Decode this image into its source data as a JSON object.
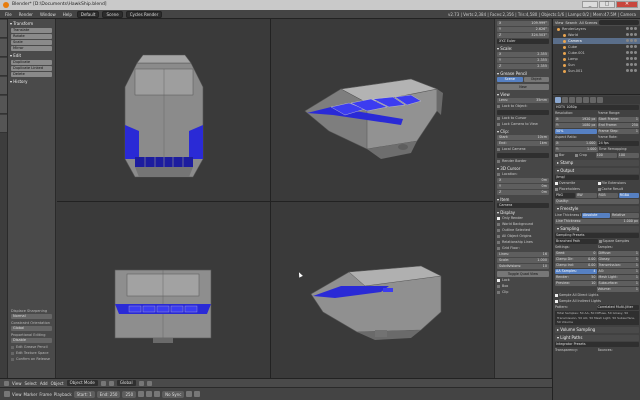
{
  "window": {
    "title": "Blender* [D:\\Documents\\HawkShip.blend]",
    "buttons": [
      "_",
      "□",
      "✕"
    ]
  },
  "infobar": {
    "menus": [
      "File",
      "Render",
      "Window",
      "Help"
    ],
    "layout": "Default",
    "scene": "Scene",
    "engine": "Cycles Render",
    "stats": "v2.73 | Verts:2,384 | Faces:2,356 | Tris:4,580 | Objects:1/6 | Lamps:0/2 | Mem:47.5M | Camera"
  },
  "toolshelf": {
    "transform_header": "Transform",
    "transform_buttons": [
      "Translate",
      "Rotate",
      "Scale",
      "Mirror"
    ],
    "edit_header": "Edit",
    "edit_buttons": [
      "Duplicate",
      "Duplicate Linked",
      "Delete"
    ],
    "history_header": "History",
    "operator": {
      "label1": "Displace Sharpening",
      "field1": "Normal",
      "label2": "Constraint Orientation",
      "field2": "Global",
      "label3": "Proportional Editing",
      "field3": "Disable",
      "checks": [
        "Edit Grease Pencil",
        "Edit Texture Space",
        "Confirm on Release"
      ]
    }
  },
  "npanel": {
    "rotation": [
      {
        "axis": "X",
        "value": "109.999°"
      },
      {
        "axis": "Y",
        "value": "2.626°"
      },
      {
        "axis": "Z",
        "value": "324.503°"
      }
    ],
    "rot_mode": "XYZ Euler",
    "scale_header": "Scale:",
    "scale": [
      {
        "axis": "X",
        "value": "2.355"
      },
      {
        "axis": "Y",
        "value": "2.355"
      },
      {
        "axis": "Z",
        "value": "2.355"
      }
    ],
    "grease_header": "Grease Pencil",
    "grease_buttons": [
      "Scene",
      "Object"
    ],
    "grease_new": "New",
    "view_header": "View",
    "lens": {
      "label": "Lens:",
      "value": "35mm"
    },
    "lock_object": "Lock to Object:",
    "lock_cursor": "Lock to Cursor",
    "lock_camera": "Lock Camera to View",
    "clip_header": "Clip:",
    "clip_start": {
      "label": "Start:",
      "value": "10cm"
    },
    "clip_end": {
      "label": "End:",
      "value": "1km"
    },
    "local_camera": "Local Camera:",
    "render_border": "Render Border",
    "cursor_header": "3D Cursor",
    "location_label": "Location:",
    "cursor": [
      {
        "axis": "X",
        "value": "0m"
      },
      {
        "axis": "Y",
        "value": "0m"
      },
      {
        "axis": "Z",
        "value": "0m"
      }
    ],
    "item_header": "Item",
    "item_name": "Camera",
    "display_header": "Display",
    "display_checks": [
      "Only Render",
      "World Background",
      "Outline Selected",
      "All Object Origins",
      "Relationship Lines"
    ],
    "grid_floor": "Grid Floor:",
    "lines": {
      "label": "Lines:",
      "value": "16"
    },
    "grid_scale": {
      "label": "Scale:",
      "value": "1.000"
    },
    "subdivisions": {
      "label": "Subdivisions:",
      "value": "10"
    },
    "toggle_quad": "Toggle Quad View",
    "quad_checks": [
      "Lock",
      "Box",
      "Clip"
    ]
  },
  "outliner": {
    "view_menu": "View",
    "search_menu": "Search",
    "scenes": "All Scenes",
    "items": [
      {
        "name": "RenderLayers",
        "sel": false
      },
      {
        "name": "World",
        "sel": false
      },
      {
        "name": "Camera",
        "sel": true
      },
      {
        "name": "Cube",
        "sel": false
      },
      {
        "name": "Cube.001",
        "sel": false
      },
      {
        "name": "Lamp",
        "sel": false
      },
      {
        "name": "Sun",
        "sel": false
      },
      {
        "name": "Sun.001",
        "sel": false
      }
    ]
  },
  "properties": {
    "preset": "HDTV 1080p",
    "resolution_label": "Resolution:",
    "frame_range_label": "Frame Range:",
    "res_x": {
      "label": "X:",
      "value": "1920 px"
    },
    "res_y": {
      "label": "Y:",
      "value": "1080 px"
    },
    "res_pct": "50%",
    "start_frame": {
      "label": "Start Frame:",
      "value": "1"
    },
    "end_frame": {
      "label": "End Frame:",
      "value": "250"
    },
    "frame_step": {
      "label": "Frame Step:",
      "value": "1"
    },
    "aspect_label": "Aspect Ratio:",
    "frame_rate_label": "Frame Rate:",
    "aspect_x": {
      "label": "X:",
      "value": "1.000"
    },
    "aspect_y": {
      "label": "Y:",
      "value": "1.000"
    },
    "fps": "24 fps",
    "time_remap": "Time Remapping:",
    "border": "Bor",
    "crop": "Crop",
    "remap_old": "100",
    "remap_new": "100",
    "stamp_header": "Stamp",
    "output_header": "Output",
    "output_path": "/tmp/",
    "overwrite": "Overwrite",
    "file_ext": "File Extensions",
    "placeholders": "Placeholders",
    "cache_result": "Cache Result",
    "format": "PNG",
    "bw": "BW",
    "rgb": "RGB",
    "rgba": "RGBA",
    "quality": "Quality:",
    "freestyle_header": "Freestyle",
    "line_thickness": "Line Thickness Mode:",
    "absolute": "Absolute",
    "relative": "Relative",
    "line_thick_value": "Line Thickness:",
    "line_thick_num": "1.000 px",
    "sampling_header": "Sampling",
    "sampling_presets": "Sampling Presets",
    "branched_path": "Branched Path",
    "square_samples": "Square Samples",
    "settings_label": "Settings:",
    "samples_label": "Samples:",
    "seed": {
      "label": "Seed:",
      "value": "0"
    },
    "clamp_dir": {
      "label": "Clamp Dir:",
      "value": "0.00"
    },
    "clamp_ind": {
      "label": "Clamp Ind:",
      "value": "0.00"
    },
    "aa": {
      "label": "AA Samples:",
      "value": "4"
    },
    "render": {
      "label": "Render:",
      "value": "50"
    },
    "preview": {
      "label": "Preview:",
      "value": "10"
    },
    "diffuse": {
      "label": "Diffuse:",
      "value": "1"
    },
    "glossy": {
      "label": "Glossy:",
      "value": "1"
    },
    "transmission": {
      "label": "Transmission:",
      "value": "1"
    },
    "ao": {
      "label": "AO:",
      "value": "1"
    },
    "mesh_light": {
      "label": "Mesh Light:",
      "value": "1"
    },
    "subsurface": {
      "label": "Subsurface:",
      "value": "1"
    },
    "volume": {
      "label": "Volume:",
      "value": "1"
    },
    "sample_all": "Sample All Direct Lights",
    "sample_all_ind": "Sample All Indirect Lights",
    "pattern_label": "Pattern:",
    "pattern": "Correlated Multi-Jitter",
    "total_samples": "Total Samples: 50 AA, 50 Diffuse, 50 Glossy, 50 Transmission, 50 AO, 50 Mesh Light, 50 Subsurface, 50 Volume",
    "vol_header": "Volume Sampling",
    "light_paths_header": "Light Paths",
    "integrator": "Integrator Presets",
    "transparency": "Transparency:",
    "bounces": "Bounces:"
  },
  "bottom": {
    "menus": [
      "View",
      "Select",
      "Add",
      "Object"
    ],
    "mode": "Object Mode",
    "pivot": "Global",
    "timeline_menus": [
      "View",
      "Marker",
      "Frame",
      "Playback"
    ],
    "start": {
      "label": "Start:",
      "value": "1"
    },
    "end": {
      "label": "End:",
      "value": "250"
    },
    "current": "250",
    "sync": "No Sync"
  }
}
